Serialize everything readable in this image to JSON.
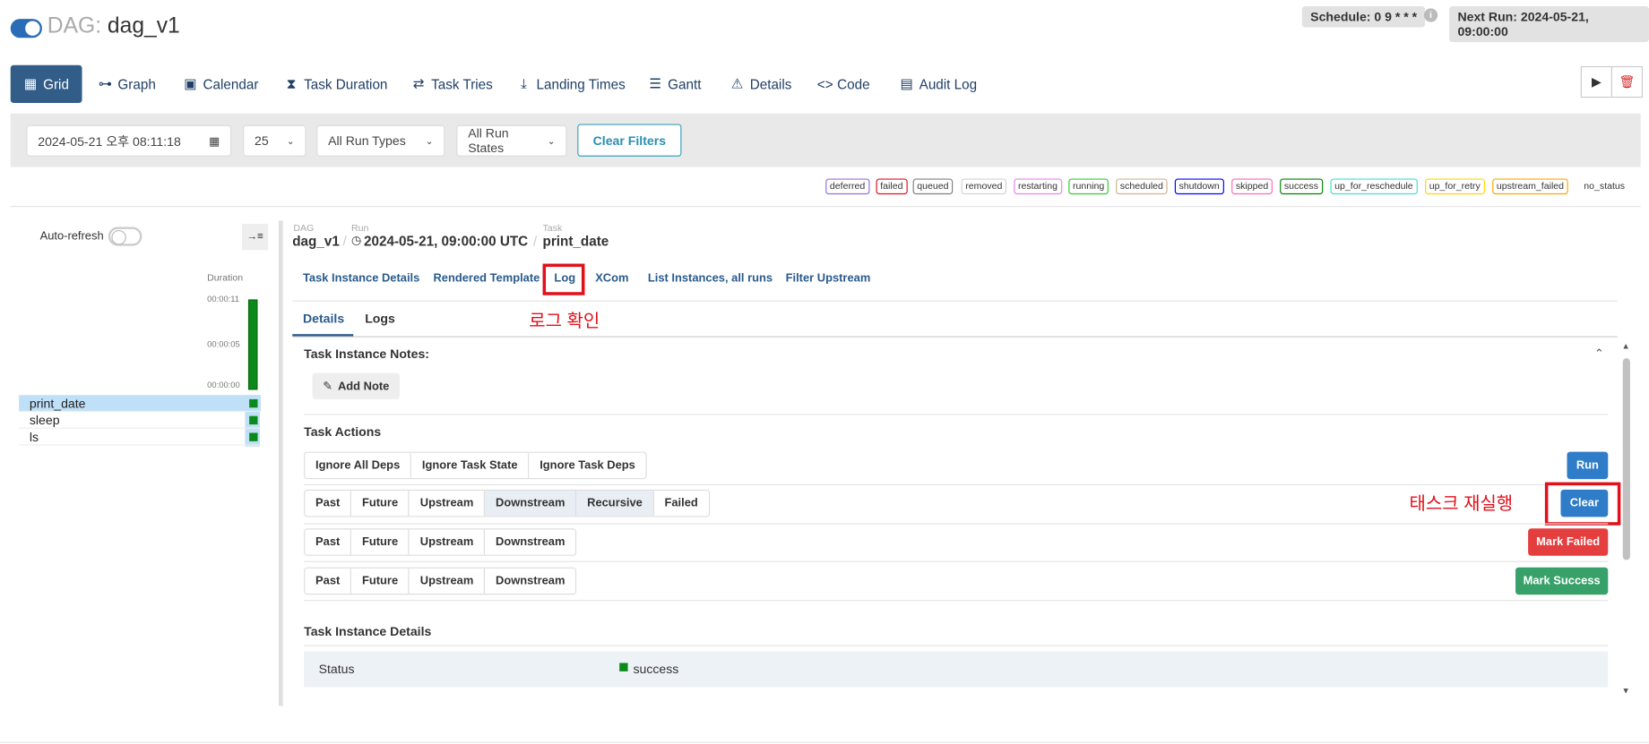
{
  "header": {
    "dag_prefix": "DAG:",
    "dag_name": "dag_v1",
    "schedule": "Schedule: 0 9 * * *",
    "next_run": "Next Run: 2024-05-21, 09:00:00"
  },
  "nav": {
    "grid": "Grid",
    "graph": "Graph",
    "calendar": "Calendar",
    "task_duration": "Task Duration",
    "task_tries": "Task Tries",
    "landing_times": "Landing Times",
    "gantt": "Gantt",
    "details": "Details",
    "code": "Code",
    "audit_log": "Audit Log"
  },
  "filters": {
    "datetime": "2024-05-21 오후 08:11:18",
    "num_runs": "25",
    "run_types": "All Run Types",
    "run_states": "All Run States",
    "clear": "Clear Filters"
  },
  "legend": [
    {
      "label": "deferred",
      "color": "#9370db"
    },
    {
      "label": "failed",
      "color": "#e0111b"
    },
    {
      "label": "queued",
      "color": "#808080"
    },
    {
      "label": "removed",
      "color": "#d3d3d3"
    },
    {
      "label": "restarting",
      "color": "#ee82ee"
    },
    {
      "label": "running",
      "color": "#32cd32"
    },
    {
      "label": "scheduled",
      "color": "#d2b48c"
    },
    {
      "label": "shutdown",
      "color": "#0000ff"
    },
    {
      "label": "skipped",
      "color": "#ff69b4"
    },
    {
      "label": "success",
      "color": "#008000"
    },
    {
      "label": "up_for_reschedule",
      "color": "#40e0d0"
    },
    {
      "label": "up_for_retry",
      "color": "#ffd700"
    },
    {
      "label": "upstream_failed",
      "color": "#ffa500"
    }
  ],
  "no_status": "no_status",
  "grid": {
    "auto_refresh": "Auto-refresh",
    "duration_label": "Duration",
    "dur_ticks": [
      "00:00:11",
      "00:00:05",
      "00:00:00"
    ],
    "tasks": [
      "print_date",
      "sleep",
      "ls"
    ]
  },
  "breadcrumb": {
    "dag_label": "DAG",
    "dag_value": "dag_v1",
    "run_label": "Run",
    "run_value": "2024-05-21, 09:00:00 UTC",
    "task_label": "Task",
    "task_value": "print_date"
  },
  "sublinks": {
    "details": "Task Instance Details",
    "rendered": "Rendered Template",
    "log": "Log",
    "xcom": "XCom",
    "list": "List Instances, all runs",
    "filter_upstream": "Filter Upstream"
  },
  "tabs": {
    "details": "Details",
    "logs": "Logs"
  },
  "annotations": {
    "log_check": "로그 확인",
    "rerun": "태스크 재실행"
  },
  "notes": {
    "title": "Task Instance Notes:",
    "add_note": "Add Note"
  },
  "actions": {
    "title": "Task Actions",
    "row1": [
      "Ignore All Deps",
      "Ignore Task State",
      "Ignore Task Deps"
    ],
    "row2": [
      "Past",
      "Future",
      "Upstream",
      "Downstream",
      "Recursive",
      "Failed"
    ],
    "row3": [
      "Past",
      "Future",
      "Upstream",
      "Downstream"
    ],
    "row4": [
      "Past",
      "Future",
      "Upstream",
      "Downstream"
    ],
    "run": "Run",
    "clear": "Clear",
    "mark_failed": "Mark Failed",
    "mark_success": "Mark Success"
  },
  "ti_details": {
    "title": "Task Instance Details",
    "status_label": "Status",
    "status_value": "success"
  }
}
